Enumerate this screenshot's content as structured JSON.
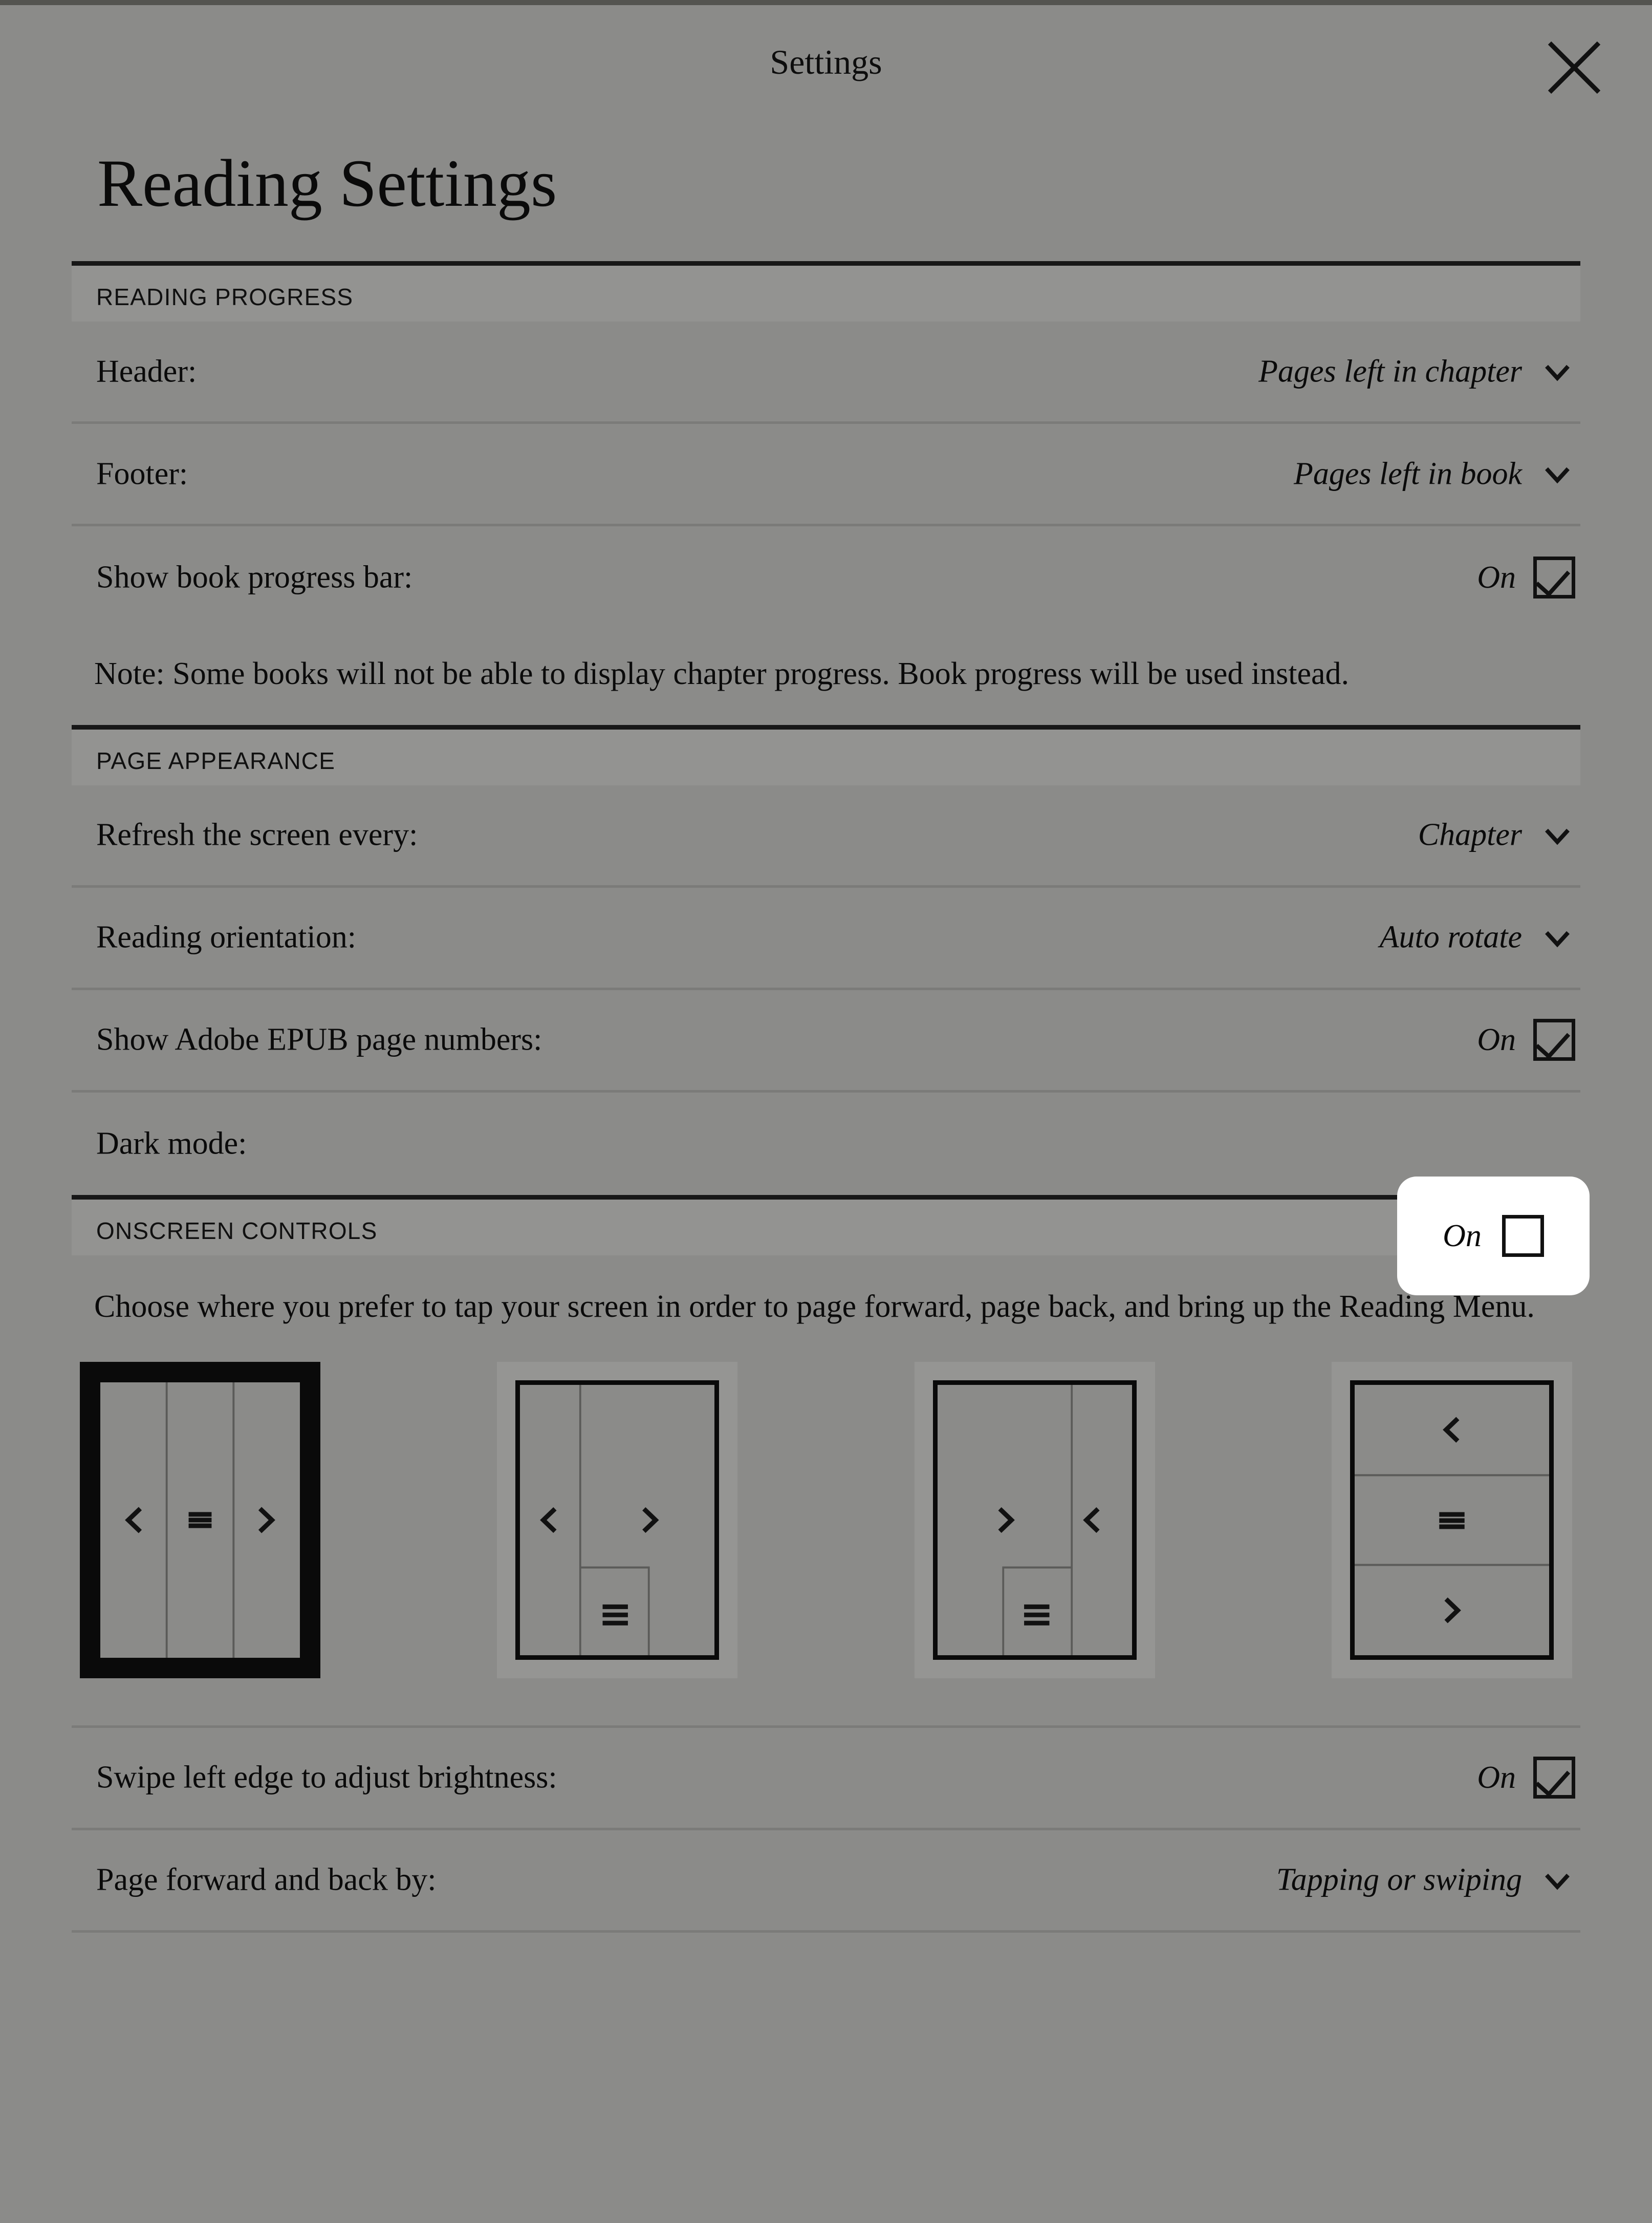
{
  "window": {
    "title": "Settings",
    "close_icon": "close-icon",
    "page_title": "Reading Settings"
  },
  "colors": {
    "background": "#8b8b89",
    "section_band": "#919190",
    "text": "#0a0a0a",
    "rule": "#7b7b79",
    "section_rule": "#171717",
    "highlight_bg": "#ffffff",
    "selected_border": "#0a0a0a"
  },
  "sections": [
    {
      "id": "reading-progress",
      "heading": "READING PROGRESS",
      "rows": [
        {
          "label": "Header:",
          "control": "dropdown",
          "value": "Pages left in chapter",
          "icon": "chevron-down-icon"
        },
        {
          "label": "Footer:",
          "control": "dropdown",
          "value": "Pages left in book",
          "icon": "chevron-down-icon"
        },
        {
          "label": "Show book progress bar:",
          "control": "checkbox",
          "value": "On",
          "checked": true
        }
      ],
      "note": "Note: Some books will not be able to display chapter progress. Book progress will be used instead."
    },
    {
      "id": "page-appearance",
      "heading": "PAGE APPEARANCE",
      "rows": [
        {
          "label": "Refresh the screen every:",
          "control": "dropdown",
          "value": "Chapter",
          "icon": "chevron-down-icon"
        },
        {
          "label": "Reading orientation:",
          "control": "dropdown",
          "value": "Auto rotate",
          "icon": "chevron-down-icon"
        },
        {
          "label": "Show Adobe EPUB page numbers:",
          "control": "checkbox",
          "value": "On",
          "checked": true
        },
        {
          "label": "Dark mode:",
          "control": "checkbox",
          "value": "On",
          "checked": false,
          "highlighted": true
        }
      ]
    },
    {
      "id": "onscreen-controls",
      "heading": "ONSCREEN CONTROLS",
      "instruction": "Choose where you prefer to tap your screen in order to page forward, page back, and bring up the Reading Menu.",
      "layout_options": [
        {
          "id": "three-columns-back-menu-forward",
          "selected": true,
          "zones": [
            "back-chevron-left-icon",
            "menu-hamburger-icon",
            "forward-chevron-right-icon"
          ]
        },
        {
          "id": "left-back-right-forward-bottom-menu",
          "selected": false,
          "zones": [
            "back-chevron-left-icon",
            "forward-chevron-right-icon",
            "menu-hamburger-icon"
          ]
        },
        {
          "id": "left-forward-right-back-bottom-menu",
          "selected": false,
          "zones": [
            "forward-chevron-right-icon",
            "back-chevron-left-icon",
            "menu-hamburger-icon"
          ]
        },
        {
          "id": "top-back-middle-menu-bottom-forward",
          "selected": false,
          "zones": [
            "back-chevron-left-icon",
            "menu-hamburger-icon",
            "forward-chevron-right-icon"
          ]
        }
      ],
      "rows": [
        {
          "label": "Swipe left edge to adjust brightness:",
          "control": "checkbox",
          "value": "On",
          "checked": true
        },
        {
          "label": "Page forward and back by:",
          "control": "dropdown",
          "value": "Tapping or swiping",
          "icon": "chevron-down-icon"
        }
      ]
    }
  ],
  "highlight": {
    "value": "On",
    "checked": false
  }
}
